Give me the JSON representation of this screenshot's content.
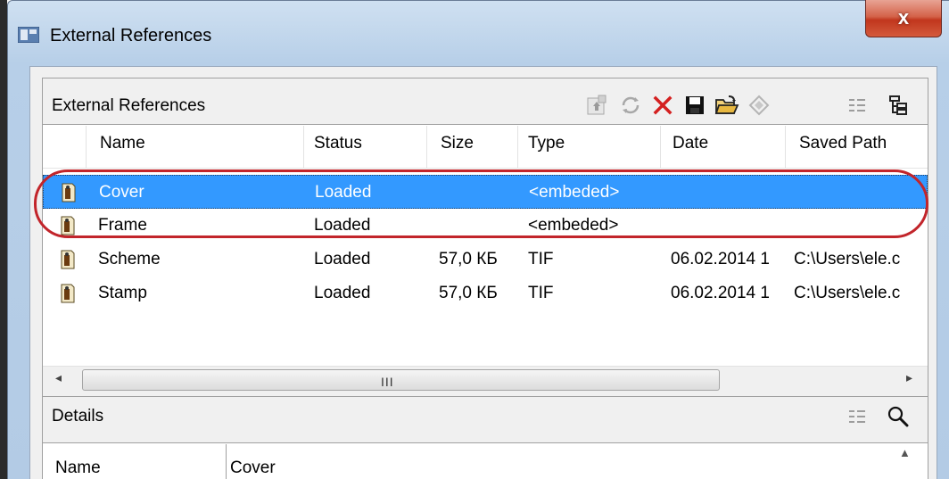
{
  "window": {
    "title": "External References",
    "close_label": "x"
  },
  "panel": {
    "header_label": "External References",
    "toolbar_icons": [
      "attach-icon",
      "reload-icon",
      "detach-icon",
      "save-icon",
      "open-folder-icon",
      "bind-icon",
      "list-view-icon",
      "tree-view-icon"
    ]
  },
  "list": {
    "columns": [
      "Name",
      "Status",
      "Size",
      "Type",
      "Date",
      "Saved Path"
    ],
    "rows": [
      {
        "name": "Cover",
        "status": "Loaded",
        "size": "",
        "type": "<embeded>",
        "date": "",
        "path": "",
        "selected": true
      },
      {
        "name": "Frame",
        "status": "Loaded",
        "size": "",
        "type": "<embeded>",
        "date": "",
        "path": "",
        "selected": false
      },
      {
        "name": "Scheme",
        "status": "Loaded",
        "size": "57,0 КБ",
        "type": "TIF",
        "date": "06.02.2014 1",
        "path": "C:\\Users\\ele.c",
        "selected": false
      },
      {
        "name": "Stamp",
        "status": "Loaded",
        "size": "57,0 КБ",
        "type": "TIF",
        "date": "06.02.2014 1",
        "path": "C:\\Users\\ele.c",
        "selected": false
      }
    ]
  },
  "hscroll": {
    "left_arrow": "◂",
    "right_arrow": "▸",
    "grip": "III"
  },
  "details": {
    "label": "Details",
    "rows": [
      {
        "name": "Name",
        "value": "Cover"
      }
    ]
  },
  "colors": {
    "selection": "#3399ff",
    "highlight_ring": "#c2252b",
    "detach_red": "#d42020"
  }
}
